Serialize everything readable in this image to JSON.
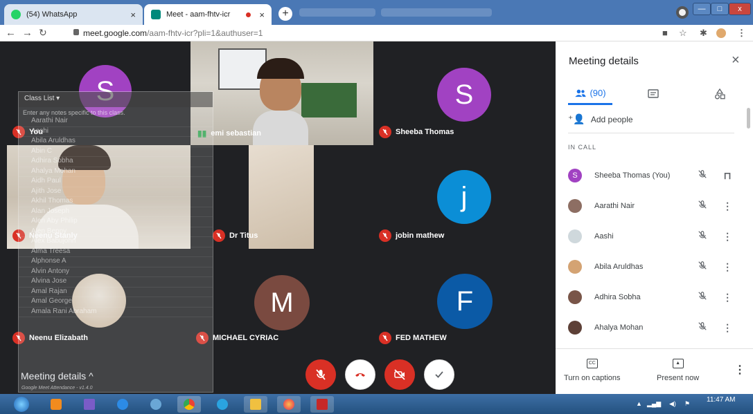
{
  "browser": {
    "tabs": [
      {
        "label": "(54) WhatsApp",
        "close": "×"
      },
      {
        "label": "Meet - aam-fhtv-icr",
        "close": "×"
      }
    ],
    "new_tab": "+",
    "url_host": "meet.google.com",
    "url_path": "/aam-fhtv-icr?pli=1&authuser=1",
    "window_controls": [
      "—",
      "□",
      "x"
    ]
  },
  "tiles": [
    {
      "name": "You",
      "initial": "S",
      "avatar_color": "#a142c2"
    },
    {
      "name": "emi sebastian"
    },
    {
      "name": "Sheeba Thomas",
      "initial": "S",
      "avatar_color": "#a142c2"
    },
    {
      "name": "Neenu Stanly"
    },
    {
      "name": "Dr Titus"
    },
    {
      "name": "jobin mathew",
      "initial": "j",
      "avatar_color": "#0b8ed6"
    },
    {
      "name": "Neenu Elizabath"
    },
    {
      "name": "MICHAEL CYRIAC",
      "initial": "M",
      "avatar_color": "#7a4a40"
    },
    {
      "name": "FED MATHEW",
      "initial": "F",
      "avatar_color": "#0b5aa6"
    }
  ],
  "class_list": {
    "title": "Class List",
    "note": "Enter any notes specific to this class.",
    "rows": [
      "Aarathi Nair",
      "Aashi",
      "Abila Aruldhas",
      "Abin C",
      "Adhira Sobha",
      "Ahalya Mohan",
      "Aidh Paul",
      "Ajith Jose",
      "Akhil Thomas",
      "Alan Joseph",
      "Alen Aby Philip",
      "Alen Benny",
      "Alex Babujohn",
      "Alma Treesa",
      "Alphonse A",
      "Alvin Antony",
      "Alvina Jose",
      "Amal Rajan",
      "Amal George",
      "Amala Rani Abraham"
    ],
    "footer": "Google Meet Attendance - v1.4.0"
  },
  "meeting_details_link": "Meeting details",
  "panel": {
    "title": "Meeting details",
    "people_count": "(90)",
    "add_people": "Add people",
    "section_label": "IN CALL",
    "participants": [
      {
        "name": "Sheeba Thomas (You)",
        "initial": "S",
        "color": "#a142c2"
      },
      {
        "name": "Aarathi Nair",
        "color": "#8d6e63"
      },
      {
        "name": "Aashi",
        "color": "#cfd8dc"
      },
      {
        "name": "Abila Aruldhas",
        "color": "#d4a373"
      },
      {
        "name": "Adhira Sobha",
        "color": "#795548"
      },
      {
        "name": "Ahalya Mohan",
        "color": "#5d4037"
      }
    ],
    "captions_label": "Turn on captions",
    "captions_icon_text": "CC",
    "present_label": "Present now"
  },
  "taskbar": {
    "time": "11:47 AM",
    "apps": [
      "start",
      "media-player",
      "mail",
      "internet-explorer",
      "settings",
      "chrome",
      "telegram",
      "file-explorer",
      "firefox",
      "pdf-reader"
    ]
  },
  "colors": {
    "meet_bg": "#202124",
    "tile_bg": "#3c4043",
    "danger": "#d93025",
    "accent": "#1a73e8"
  }
}
